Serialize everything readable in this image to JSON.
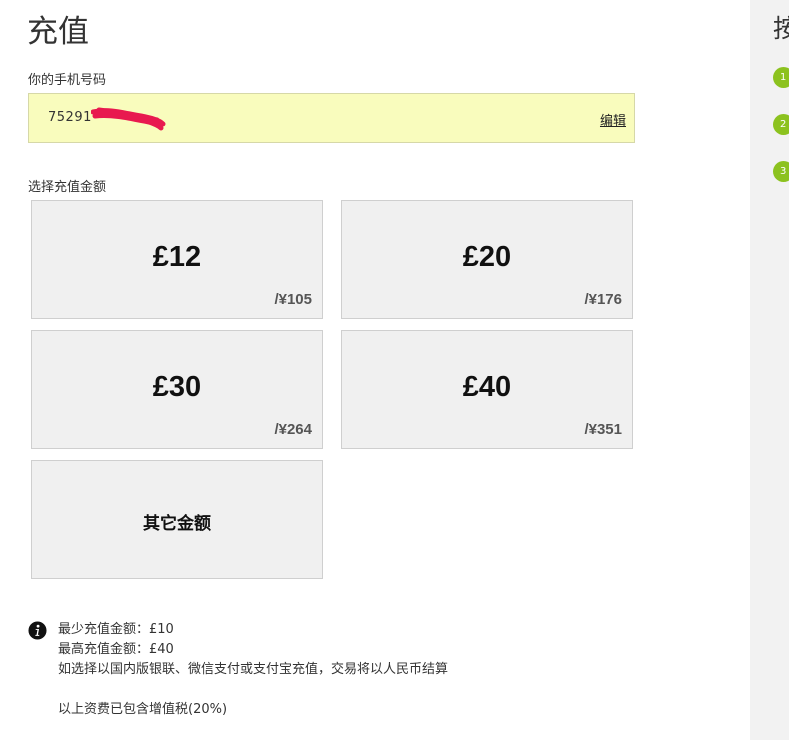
{
  "page": {
    "title": "充值"
  },
  "phone": {
    "label": "你的手机号码",
    "number_visible": "75291",
    "edit_label": "编辑",
    "background_color": "#f9fcbd",
    "redaction_color": "#e8194f"
  },
  "amounts": {
    "label": "选择充值金额",
    "options": [
      {
        "gbp": "£12",
        "cny": "/¥105"
      },
      {
        "gbp": "£20",
        "cny": "/¥176"
      },
      {
        "gbp": "£30",
        "cny": "/¥264"
      },
      {
        "gbp": "£40",
        "cny": "/¥351"
      }
    ],
    "other_label": "其它金额"
  },
  "info": {
    "icon": "info-icon",
    "lines": [
      "最少充值金额：£10",
      "最高充值金额：£40",
      "如选择以国内版银联、微信支付或支付宝充值，交易将以人民币结算"
    ],
    "vat_note": "以上资费已包含增值税(20%)"
  },
  "sidebar": {
    "title": "按",
    "steps": [
      "1",
      "2",
      "3"
    ],
    "accent_color": "#8cc21f"
  }
}
